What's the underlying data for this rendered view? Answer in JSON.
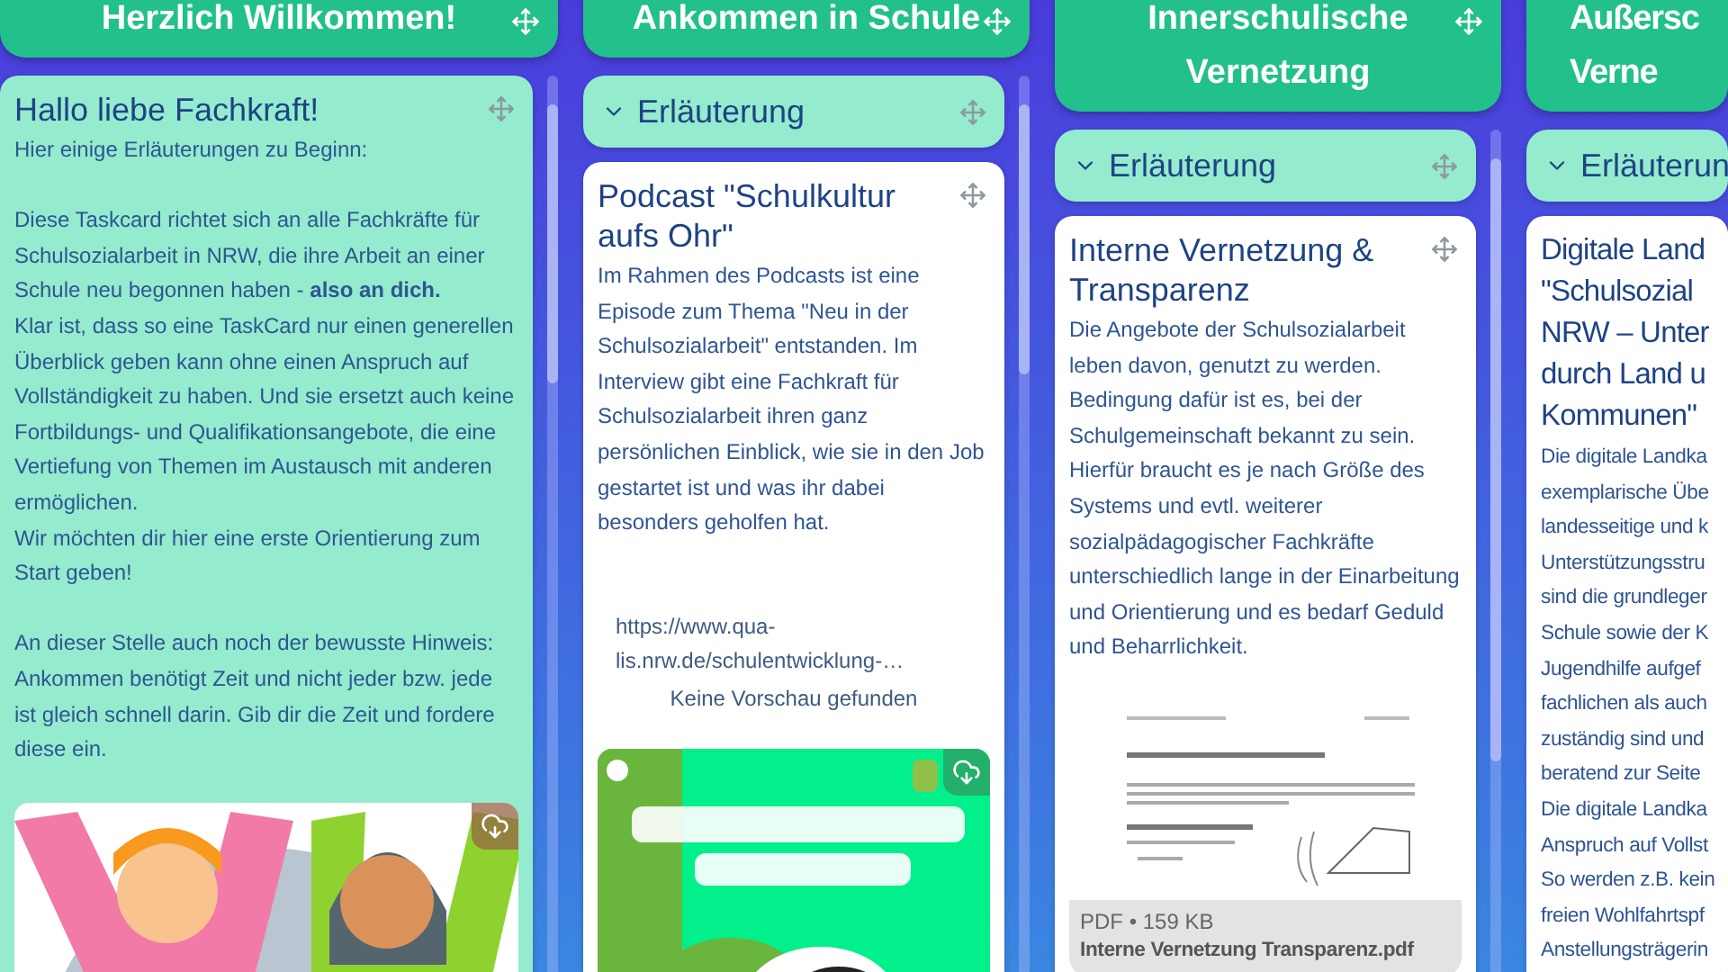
{
  "columns": [
    {
      "title_lines": [
        "Herzlich Willkommen!"
      ],
      "items": [
        {
          "kind": "note",
          "title_lines": [
            "Hallo liebe Fachkraft!"
          ],
          "paragraphs": [
            [
              "Hier einige Erläuterungen zu Beginn:"
            ],
            [
              "Diese Taskcard richtet sich an alle Fachkräfte für Schulsozialarbeit in NRW, die ihre Arbeit an einer Schule neu begonnen haben - **also an dich.**",
              "Klar ist, dass so eine TaskCard nur einen generellen Überblick geben kann ohne einen Anspruch auf Vollständigkeit zu haben. Und sie ersetzt auch keine Fortbildungs- und Qualifikationsangebote, die eine Vertiefung von Themen im Austausch mit anderen ermöglichen.",
              "Wir möchten dir hier eine erste Orientierung zum Start geben!"
            ],
            [
              "An dieser Stelle auch noch der bewusste Hinweis: Ankommen benötigt Zeit und nicht jeder bzw. jede ist gleich schnell darin. Gib dir die Zeit und fordere diese ein."
            ]
          ],
          "attachment": {
            "kind": "picture"
          }
        }
      ]
    },
    {
      "title_lines": [
        "Ankommen in Schule"
      ],
      "items": [
        {
          "kind": "section",
          "label": "Erläuterung",
          "expanded": true
        },
        {
          "kind": "card",
          "title_lines": [
            "Podcast \"Schulkultur aufs Ohr\""
          ],
          "paragraphs": [
            [
              "Im Rahmen des Podcasts ist eine Episode zum Thema \"Neu in der Schulsozialarbeit\" entstanden. Im Interview gibt eine Fachkraft für Schulsozialarbeit ihren ganz persönlichen Einblick, wie sie in den Job gestartet ist und was ihr dabei besonders geholfen hat."
            ]
          ],
          "link": {
            "url": "https://www.qua-lis.nrw.de/schulentwicklung-…",
            "note": "Keine Vorschau gefunden"
          },
          "attachment": {
            "kind": "picture"
          }
        }
      ]
    },
    {
      "title_lines": [
        "Innerschulische",
        "Vernetzung"
      ],
      "items": [
        {
          "kind": "section",
          "label": "Erläuterung",
          "expanded": true
        },
        {
          "kind": "card",
          "title_lines": [
            "Interne Vernetzung & Transparenz"
          ],
          "paragraphs": [
            [
              "Die Angebote der Schulsozialarbeit leben davon, genutzt zu werden. Bedingung dafür ist es, bei der Schulgemeinschaft bekannt zu sein. Hierfür braucht es je nach Größe des Systems und evtl. weiterer sozialpädagogischer Fachkräfte unterschiedlich lange in der Einarbeitung und Orientierung und es bedarf Geduld und Beharrlichkeit."
            ]
          ],
          "attachment": {
            "kind": "file",
            "meta": "PDF • 159 KB",
            "filename": "Interne Vernetzung Transparenz.pdf"
          }
        }
      ]
    },
    {
      "title_lines": [
        "Außersc",
        "Verne"
      ],
      "items": [
        {
          "kind": "section",
          "label": "Erläuterun",
          "expanded": true
        },
        {
          "kind": "card",
          "title_lines": [
            "Digitale Land",
            "\"Schulsozial",
            "NRW – Unter",
            "durch Land u",
            "Kommunen\""
          ],
          "paragraphs": [
            [
              "Die digitale Landka",
              "exemplarische Übe",
              "landesseitige und k",
              "Unterstützungsstru",
              "sind die grundleger",
              "Schule sowie der K",
              "Jugendhilfe aufgef",
              "fachlichen als auch",
              "zuständig sind und",
              "beratend zur Seite",
              "Die digitale Landka",
              "Anspruch auf Vollst",
              "So werden z.B. kein",
              "freien Wohlfahrtspf",
              "Anstellungsträgerin"
            ]
          ]
        }
      ]
    }
  ]
}
